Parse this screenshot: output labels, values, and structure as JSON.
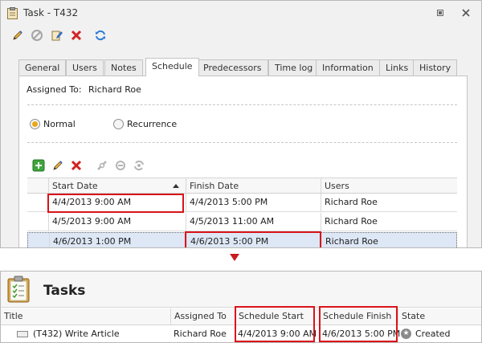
{
  "window": {
    "title": "Task - T432",
    "toolbar_icons": [
      "edit-icon",
      "cancel-icon",
      "edit-note-icon",
      "delete-icon",
      "refresh-icon"
    ],
    "controls": [
      "restore-icon",
      "close-icon"
    ]
  },
  "tabs": [
    "General",
    "Users",
    "Notes",
    "Schedule",
    "Predecessors",
    "Time log",
    "Information",
    "Links",
    "History"
  ],
  "active_tab": "Schedule",
  "schedule": {
    "assigned_label": "Assigned To:",
    "assigned_value": "Richard Roe",
    "radio_normal": "Normal",
    "radio_recurrence": "Recurrence",
    "selected_radio": "Normal",
    "grid_toolbar_icons": [
      "add-icon",
      "edit-icon",
      "delete-icon",
      "link-icon",
      "unlink-icon",
      "refresh-icon"
    ],
    "columns": [
      "Start Date",
      "Finish Date",
      "Users"
    ],
    "sorted_column": "Start Date",
    "rows": [
      {
        "start": "4/4/2013 9:00 AM",
        "finish": "4/4/2013 5:00 PM",
        "users": "Richard Roe"
      },
      {
        "start": "4/5/2013 9:00 AM",
        "finish": "4/5/2013 11:00 AM",
        "users": "Richard Roe"
      },
      {
        "start": "4/6/2013 1:00 PM",
        "finish": "4/6/2013 5:00 PM",
        "users": "Richard Roe"
      }
    ],
    "selected_row": 2
  },
  "tasks_list": {
    "title": "Tasks",
    "columns": [
      "Title",
      "Assigned To",
      "Schedule Start",
      "Schedule Finish",
      "State"
    ],
    "row": {
      "title": "(T432) Write Article",
      "assigned_to": "Richard Roe",
      "schedule_start": "4/4/2013 9:00 AM",
      "schedule_finish": "4/6/2013 5:00 PM",
      "state": "Created"
    }
  },
  "colors": {
    "highlight": "#d9131b",
    "arrow": "#c81b1b",
    "selected_row": "#dde7f5",
    "radio_accent": "#e8a817"
  }
}
